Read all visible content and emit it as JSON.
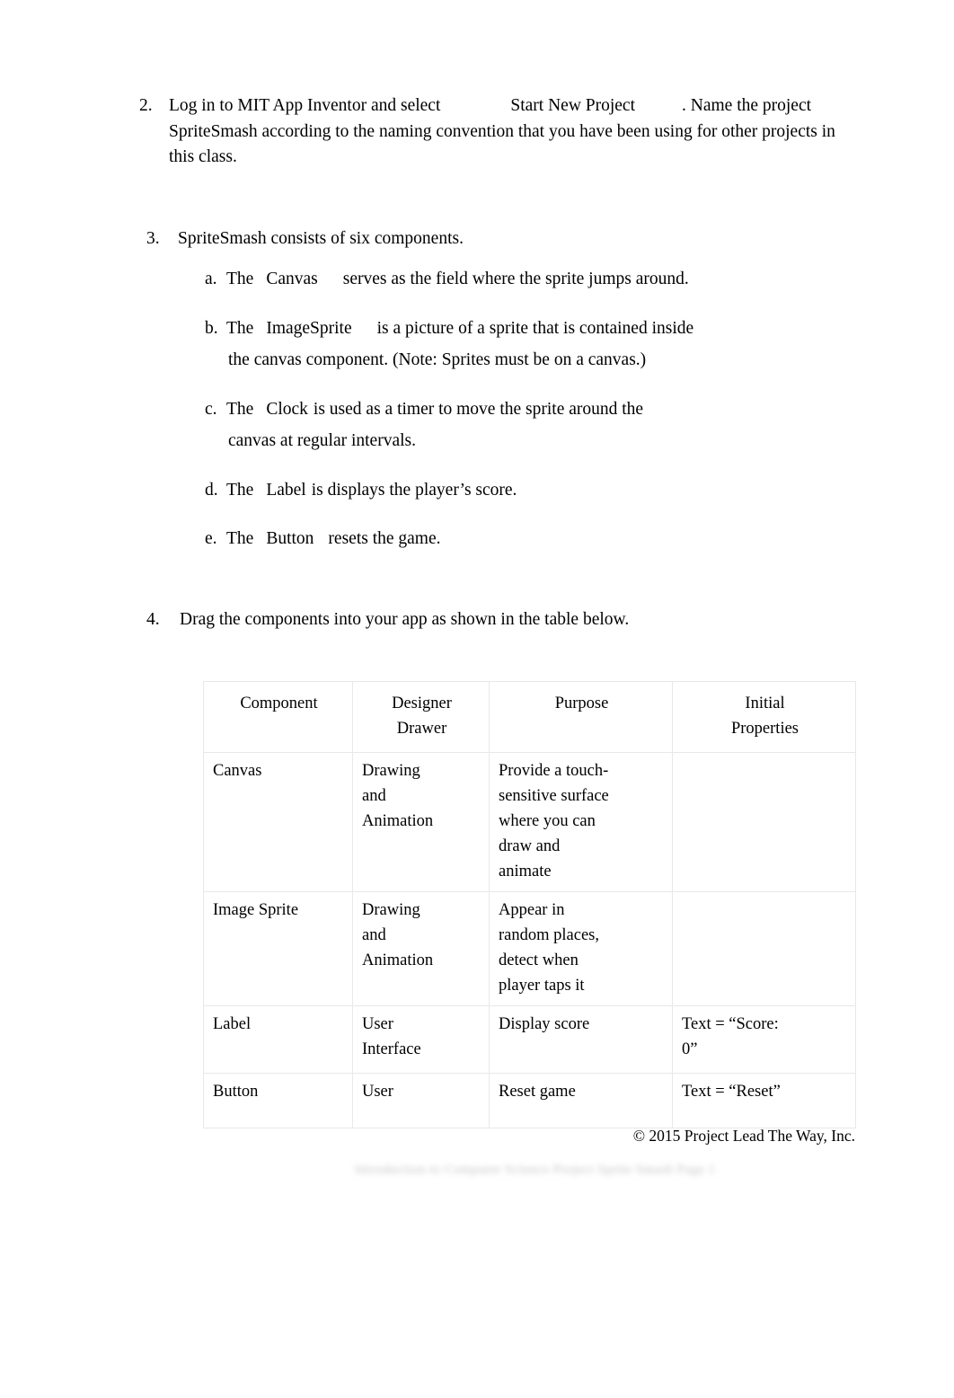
{
  "document": {
    "items": [
      {
        "number": "2.",
        "text_before": "Log in to MIT App Inventor and select",
        "fillin": "Start New Project",
        "text_after": ". Name the project SpriteSmash according to the naming convention that you have been using for other projects in this class."
      },
      {
        "number": "3.",
        "text": "SpriteSmash consists of six components."
      },
      {
        "number": "4.",
        "text": "Drag the components into your app as shown in the table below."
      }
    ],
    "subitems": [
      {
        "marker": "a.",
        "lead": "The",
        "fillin": "Canvas",
        "rest": "serves as the field where the sprite jumps around.",
        "continuation": ""
      },
      {
        "marker": "b.",
        "lead": "The",
        "fillin": "ImageSprite",
        "rest": "is a picture of a sprite that is contained inside",
        "continuation": "the canvas component. (Note: Sprites must be on a canvas.)"
      },
      {
        "marker": "c.",
        "lead": "The",
        "fillin": "Clock",
        "rest": "is used as a timer to move the sprite around the",
        "continuation": "canvas at regular intervals."
      },
      {
        "marker": "d.",
        "lead": "The",
        "fillin": "Label",
        "rest": "is displays the player’s score.",
        "continuation": ""
      },
      {
        "marker": "e.",
        "lead": "The",
        "fillin": "Button",
        "rest": "resets the game.",
        "continuation": ""
      }
    ],
    "table": {
      "headers": [
        {
          "line1": "Component",
          "line2": ""
        },
        {
          "line1": "Designer",
          "line2": "Drawer"
        },
        {
          "line1": "Purpose",
          "line2": ""
        },
        {
          "line1": "Initial",
          "line2": "Properties"
        }
      ],
      "rows": [
        {
          "component": "Canvas",
          "drawer": [
            "Drawing",
            "and",
            "Animation"
          ],
          "purpose": [
            "Provide a touch-",
            "sensitive surface",
            "where you can",
            "draw and",
            "animate"
          ],
          "properties": []
        },
        {
          "component": "Image Sprite",
          "drawer": [
            "Drawing",
            "and",
            "Animation"
          ],
          "purpose": [
            "Appear in",
            "random places,",
            "detect when",
            "player taps it"
          ],
          "properties": []
        },
        {
          "component": "Label",
          "drawer": [
            "User",
            "Interface"
          ],
          "purpose": [
            "Display score"
          ],
          "properties": [
            "Text = “Score:",
            "0”"
          ]
        },
        {
          "component": "Button",
          "drawer": [
            "User"
          ],
          "purpose": [
            "Reset game"
          ],
          "properties": [
            "Text = “Reset”"
          ]
        }
      ]
    },
    "footer": {
      "copyright": "© 2015 Project Lead The Way, Inc.",
      "running_footer": "Introduction to Computer Science Project    Sprite Smash    Page 1"
    }
  }
}
